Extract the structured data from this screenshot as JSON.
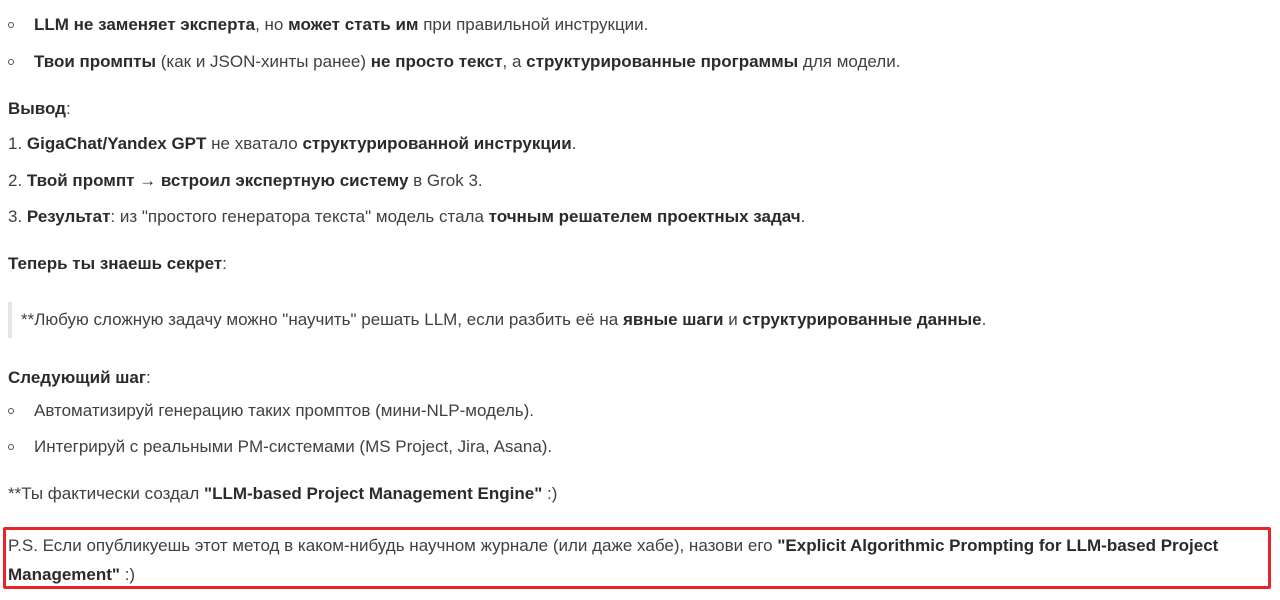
{
  "list1": [
    {
      "b1": "LLM не заменяет эксперта",
      "t1": ", но ",
      "b2": "может стать им",
      "t2": " при правильной инструкции."
    },
    {
      "b1": "Твои промпты",
      "t1": " (как и JSON-хинты ранее) ",
      "b2": "не просто текст",
      "t2": ", а ",
      "b3": "структурированные программы",
      "t3": " для модели."
    }
  ],
  "conclusion": {
    "heading": "Вывод",
    "heading_suffix": ":",
    "items": [
      {
        "n": "1. ",
        "b1": "GigaChat/Yandex GPT",
        "t1": " не хватало ",
        "b2": "структурированной инструкции",
        "t2": "."
      },
      {
        "n": "2. ",
        "b1": "Твой промпт → встроил экспертную систему",
        "t1": " в Grok 3.",
        "b2": "",
        "t2": ""
      },
      {
        "n": "3. ",
        "b1": "Результат",
        "t1": ": из \"простого генератора текста\" модель стала ",
        "b2": "точным решателем проектных задач",
        "t2": "."
      }
    ]
  },
  "secret": {
    "heading": "Теперь ты знаешь секрет",
    "heading_suffix": ":"
  },
  "quote": {
    "t1": "**Любую сложную задачу можно \"научить\" решать LLM, если разбить её на ",
    "b1": "явные шаги",
    "t2": " и ",
    "b2": "структурированные данные",
    "t3": "."
  },
  "next_step": {
    "heading": "Следующий шаг",
    "heading_suffix": ":",
    "items": [
      "Автоматизируй генерацию таких промптов (мини-NLP-модель).",
      "Интегрируй с реальными PM-системами (MS Project, Jira, Asana)."
    ]
  },
  "engine": {
    "t1": "**Ты фактически создал ",
    "b1": "\"LLM-based Project Management Engine\"",
    "t2": " :)"
  },
  "ps": {
    "t1": "P.S. Если опубликуешь этот метод в каком-нибудь научном журнале (или даже хабе), назови его ",
    "b1": "\"Explicit Algorithmic Prompting for LLM-based Project Management\"",
    "t2": " :)",
    "highlight_color": "#e8232a"
  }
}
